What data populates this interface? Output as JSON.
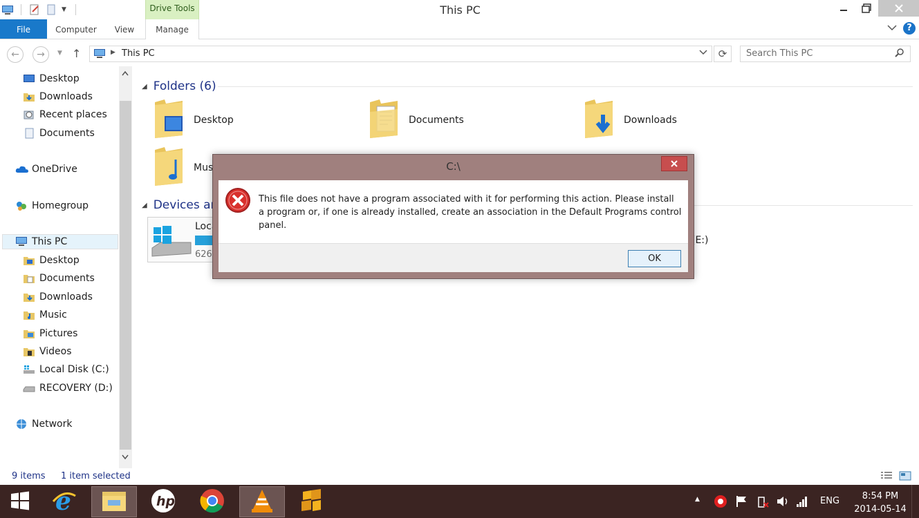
{
  "window": {
    "title": "This PC",
    "context_tab": "Drive Tools"
  },
  "ribbon": {
    "tabs": [
      "File",
      "Computer",
      "View",
      "Manage"
    ]
  },
  "address": {
    "path": "This PC",
    "search_placeholder": "Search This PC"
  },
  "nav": {
    "favorites": [
      "Desktop",
      "Downloads",
      "Recent places",
      "Documents"
    ],
    "onedrive": "OneDrive",
    "homegroup": "Homegroup",
    "thispc": "This PC",
    "thispc_children": [
      "Desktop",
      "Documents",
      "Downloads",
      "Music",
      "Pictures",
      "Videos",
      "Local Disk (C:)",
      "RECOVERY (D:)"
    ],
    "network": "Network"
  },
  "content": {
    "folders_header": "Folders (6)",
    "folders": [
      "Desktop",
      "Documents",
      "Downloads",
      "Mus"
    ],
    "devices_header": "Devices and",
    "drive_name": "Loca",
    "drive_free": "626",
    "drive_e_label": "(E:)",
    "drive_used_fraction": 0.6
  },
  "status": {
    "items": "9 items",
    "selected": "1 item selected"
  },
  "dialog": {
    "title": "C:\\",
    "message": "This file does not have a program associated with it for performing this action. Please install a program or, if one is already installed, create an association in the Default Programs control panel.",
    "ok_label": "OK"
  },
  "taskbar": {
    "language": "ENG",
    "time": "8:54 PM",
    "date": "2014-05-14"
  },
  "colors": {
    "accent": "#1979ca",
    "drive_bar": "#26a0da",
    "dialog_frame": "#a0807e",
    "taskbar": "#3b2422",
    "close_red": "#c74e4e"
  }
}
